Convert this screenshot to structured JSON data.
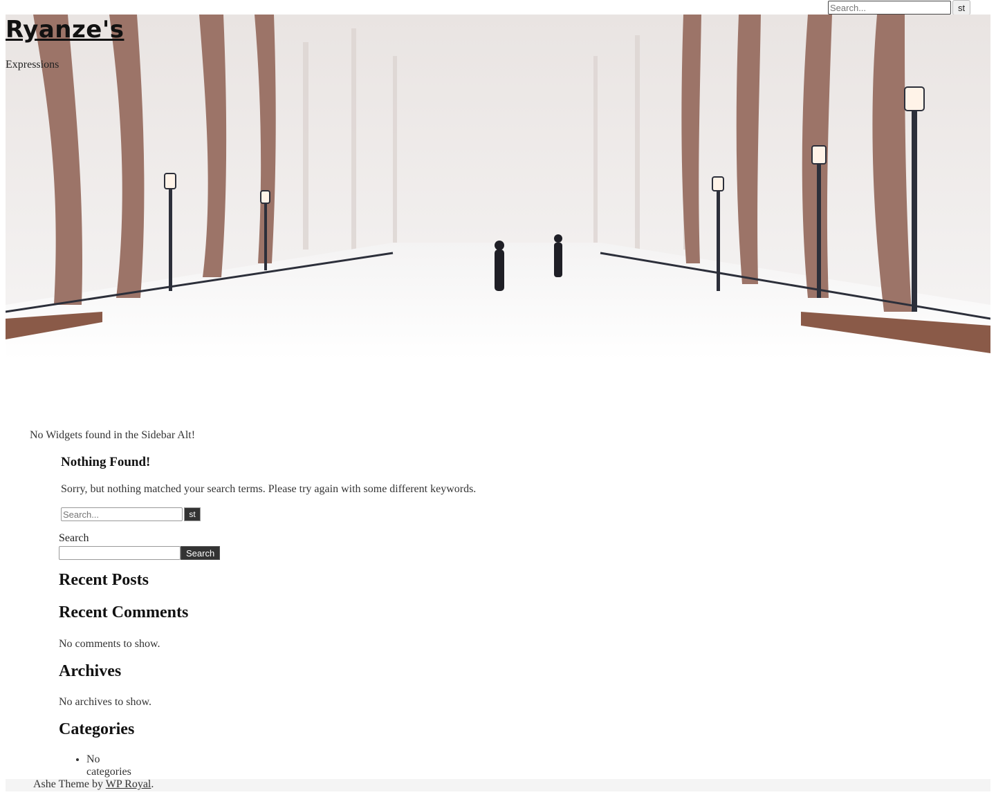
{
  "top_search": {
    "placeholder": "Search...",
    "button_label": "st"
  },
  "header": {
    "site_title": "Ryanze's",
    "tagline": "Expressions"
  },
  "sidebar_alt": {
    "message": "No Widgets found in the Sidebar Alt!"
  },
  "main": {
    "title": "Nothing Found!",
    "message": "Sorry, but nothing matched your search terms. Please try again with some different keywords.",
    "search": {
      "placeholder": "Search...",
      "button_label": "st"
    }
  },
  "widgets": {
    "search": {
      "label": "Search",
      "button_label": "Search"
    },
    "recent_posts": {
      "title": "Recent Posts"
    },
    "recent_comments": {
      "title": "Recent Comments",
      "empty": "No comments to show."
    },
    "archives": {
      "title": "Archives",
      "empty": "No archives to show."
    },
    "categories": {
      "title": "Categories",
      "items": [
        "No categories"
      ]
    }
  },
  "footer": {
    "prefix": "Ashe Theme by ",
    "link_text": "WP Royal",
    "suffix": "."
  }
}
